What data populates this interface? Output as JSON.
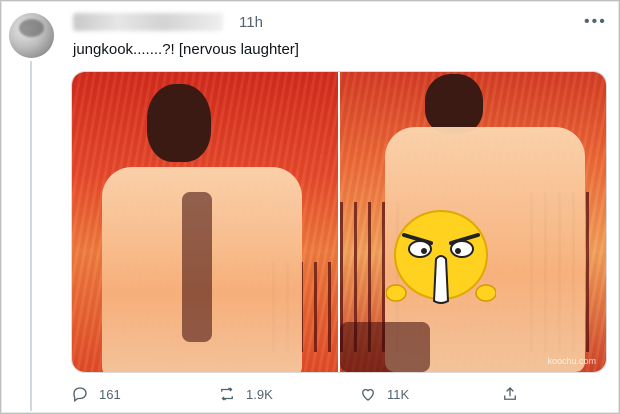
{
  "tweet": {
    "time": "11h",
    "text": "jungkook.......?! [nervous laughter]",
    "more_icon": "more-dots-icon"
  },
  "media": {
    "watermark": "koochu.com"
  },
  "actions": {
    "reply_count": "161",
    "retweet_count": "1.9K",
    "like_count": "11K"
  },
  "colors": {
    "text": "#0f1419",
    "muted": "#536471",
    "stage_red": "#d42b1c",
    "emoji_yellow": "#ffd21f"
  }
}
